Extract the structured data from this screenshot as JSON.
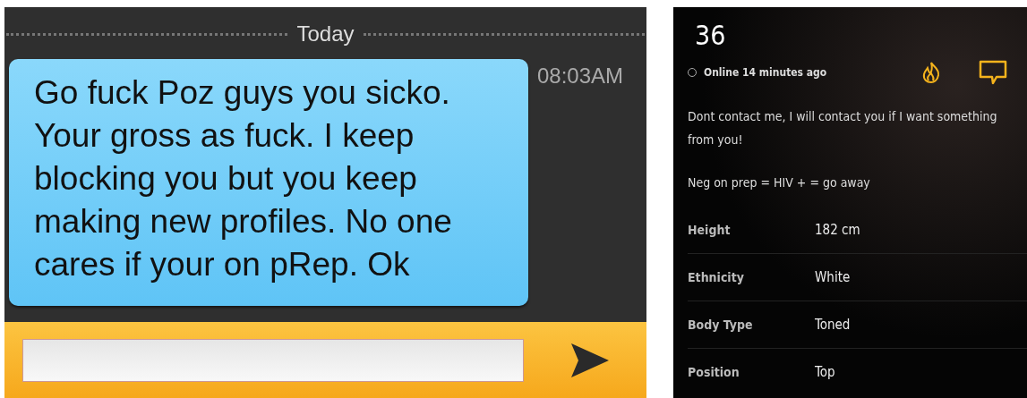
{
  "chat": {
    "date_divider": "Today",
    "messages": [
      {
        "text": "Go fuck Poz guys you sicko. Your gross as fuck. I keep blocking you but you keep making new profiles. No one cares if your on pRep. Ok",
        "time": "08:03AM"
      }
    ]
  },
  "profile": {
    "age": "36",
    "status": "Online 14 minutes ago",
    "bio": [
      "Dont contact me, I will contact you if I want something from you!",
      "Neg on prep = HIV + = go away"
    ],
    "stats": [
      {
        "label": "Height",
        "value": "182 cm"
      },
      {
        "label": "Ethnicity",
        "value": "White"
      },
      {
        "label": "Body Type",
        "value": "Toned"
      },
      {
        "label": "Position",
        "value": "Top"
      }
    ]
  }
}
